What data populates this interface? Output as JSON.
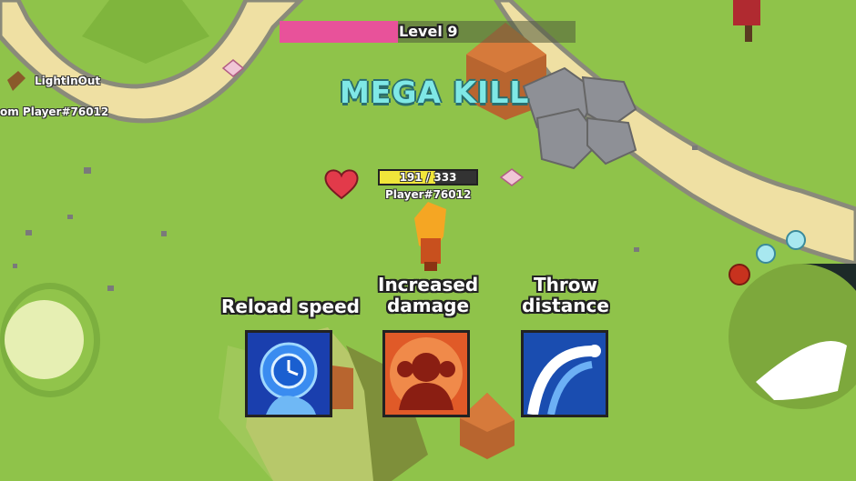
{
  "hud": {
    "level_label": "Level 9",
    "level_progress": 0.4
  },
  "announcement": "MEGA KILL",
  "player": {
    "hp_text": "191 / 333",
    "hp_current": 191,
    "hp_max": 333,
    "name": "Player#76012"
  },
  "enemies": [
    {
      "name": "LightInOut"
    },
    {
      "name": "om Player#76012"
    }
  ],
  "upgrades": [
    {
      "label": "Reload speed",
      "icon": "clock-icon",
      "color": "#1a6ee0"
    },
    {
      "label": "Increased damage",
      "icon": "power-icon",
      "color": "#e0401a"
    },
    {
      "label": "Throw distance",
      "icon": "arc-icon",
      "color": "#1e5fc4"
    }
  ],
  "colors": {
    "grass": "#8fc34a",
    "path": "#efe0a3",
    "level_fill": "#e8529a",
    "hp_fill": "#f1e63a",
    "mega_text": "#7fe8e6"
  }
}
